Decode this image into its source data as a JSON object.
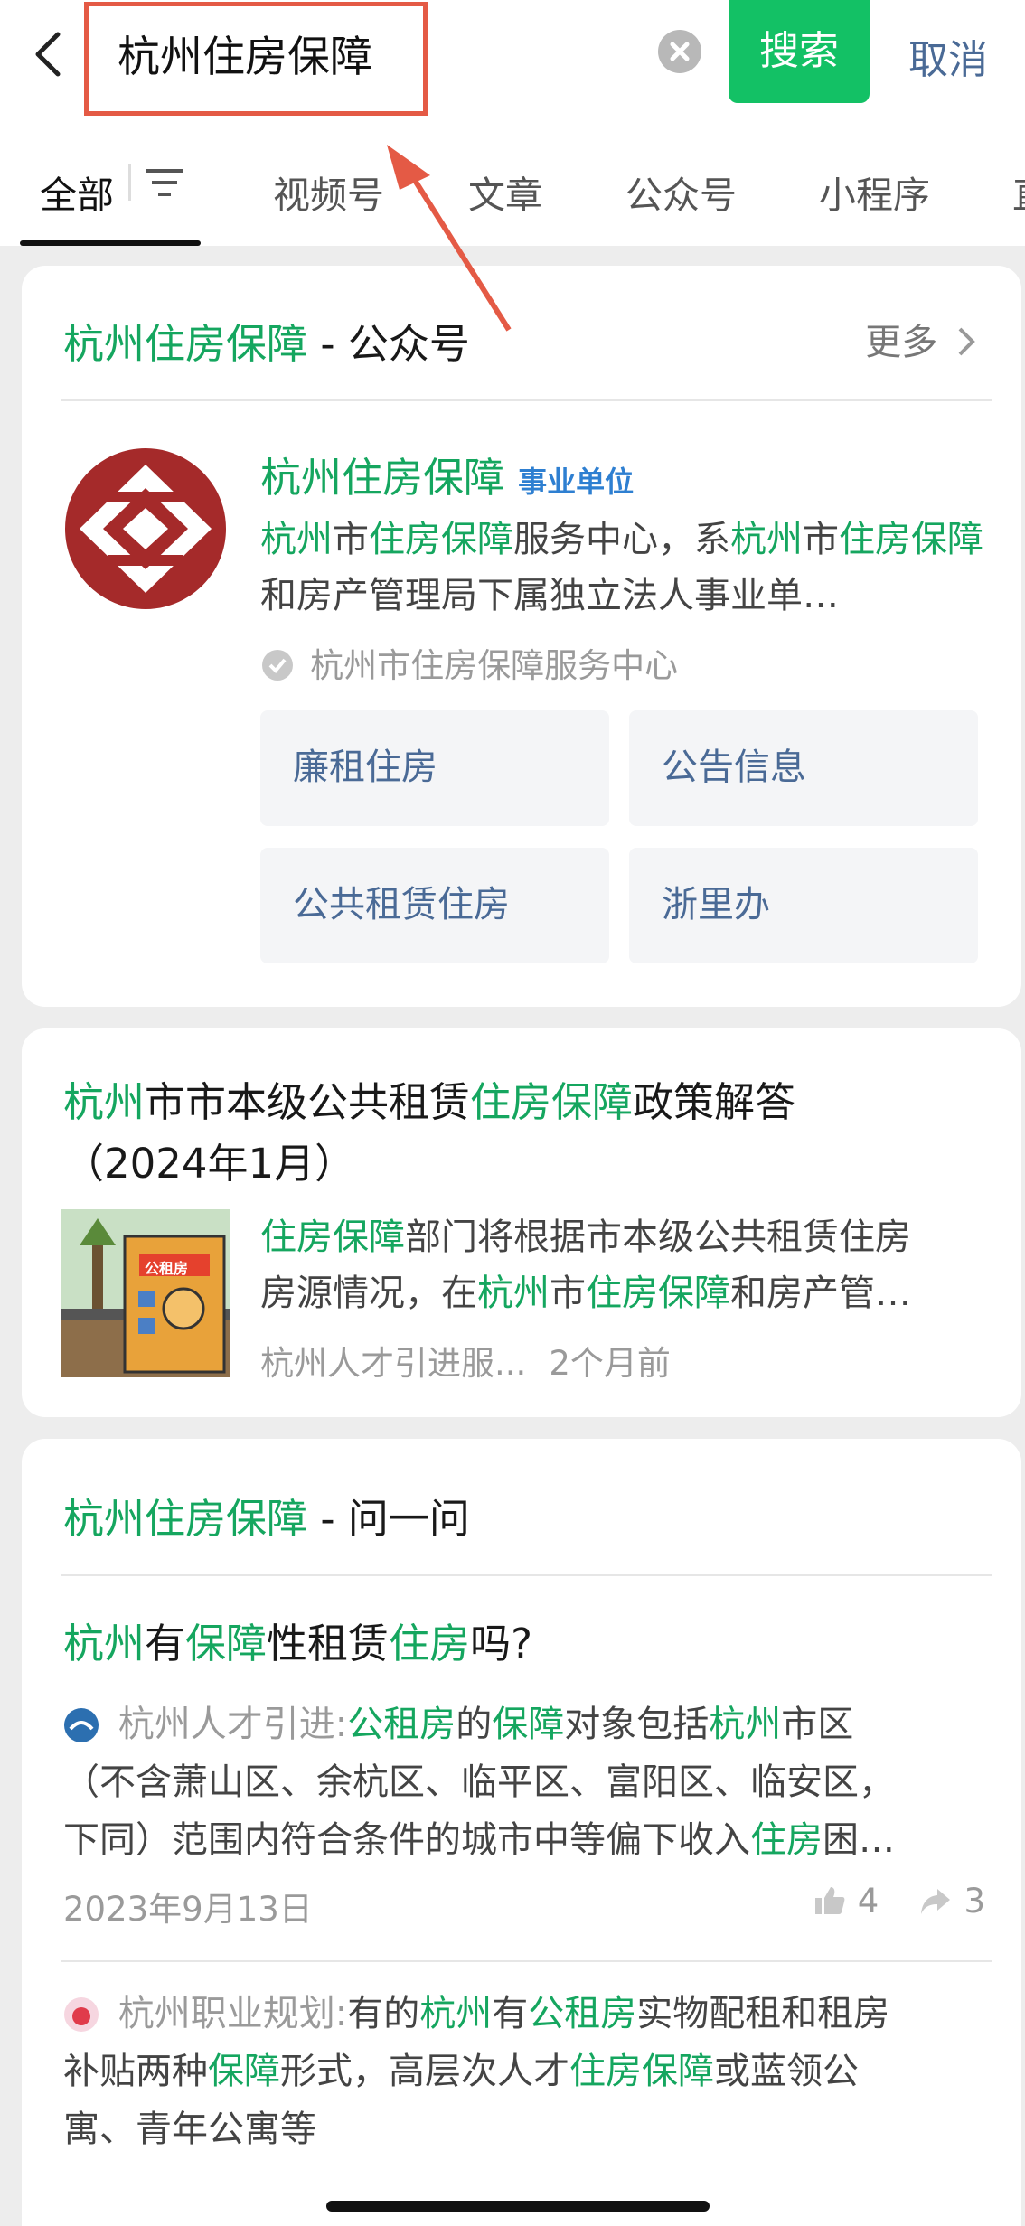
{
  "header": {
    "search_value": "杭州住房保障",
    "search_button": "搜索",
    "cancel": "取消"
  },
  "tabs": [
    "全部",
    "视频号",
    "文章",
    "公众号",
    "小程序",
    "直"
  ],
  "account_card": {
    "title_hl": "杭州住房保障",
    "title_rest": " - 公众号",
    "more": "更多",
    "name": "杭州住房保障",
    "tag": "事业单位",
    "desc_parts": [
      {
        "t": "杭州",
        "h": true
      },
      {
        "t": "市",
        "h": false
      },
      {
        "t": "住房保障",
        "h": true
      },
      {
        "t": "服务中心，系",
        "h": false
      },
      {
        "t": "杭州",
        "h": true
      },
      {
        "t": "市",
        "h": false
      },
      {
        "t": "住房保障",
        "h": true
      },
      {
        "t": "和房产管理局下属独立法人事业单…",
        "h": false
      }
    ],
    "verified": "杭州市住房保障服务中心",
    "quick_links": [
      "廉租住房",
      "公告信息",
      "公共租赁住房",
      "浙里办"
    ]
  },
  "article_card": {
    "title_parts": [
      {
        "t": "杭州",
        "h": true
      },
      {
        "t": "市市本级公共租赁",
        "h": false
      },
      {
        "t": "住房保障",
        "h": true
      },
      {
        "t": "政策解答",
        "h": false
      }
    ],
    "title_line2": "（2024年1月）",
    "snippet_parts": [
      {
        "t": "住房保障",
        "h": true
      },
      {
        "t": "部门将根据市本级公共租赁住房",
        "h": false
      }
    ],
    "snippet_line2_parts": [
      {
        "t": "房源情况，在",
        "h": false
      },
      {
        "t": "杭州",
        "h": true
      },
      {
        "t": "市",
        "h": false
      },
      {
        "t": "住房保障",
        "h": true
      },
      {
        "t": "和房产管…",
        "h": false
      }
    ],
    "thumb_label": "公租房",
    "source": "杭州人才引进服...",
    "time": "2个月前"
  },
  "qa_card": {
    "title_hl": "杭州住房保障",
    "title_rest": " - 问一问",
    "question_parts": [
      {
        "t": "杭州",
        "h": true
      },
      {
        "t": "有",
        "h": false
      },
      {
        "t": "保障",
        "h": true
      },
      {
        "t": "性租赁",
        "h": false
      },
      {
        "t": "住房",
        "h": true
      },
      {
        "t": "吗?",
        "h": false
      }
    ],
    "answer1": {
      "author": "杭州人才引进:",
      "l1": [
        {
          "t": "公租房",
          "h": true
        },
        {
          "t": "的",
          "h": false
        },
        {
          "t": "保障",
          "h": true
        },
        {
          "t": "对象包括",
          "h": false
        },
        {
          "t": "杭州",
          "h": true
        },
        {
          "t": "市区",
          "h": false
        }
      ],
      "l2": "（不含萧山区、余杭区、临平区、富阳区、临安区，",
      "l3": [
        {
          "t": "下同）范围内符合条件的城市中等偏下收入",
          "h": false
        },
        {
          "t": "住房",
          "h": true
        },
        {
          "t": "困…",
          "h": false
        }
      ],
      "date": "2023年9月13日",
      "likes": "4",
      "shares": "3"
    },
    "answer2": {
      "author": "杭州职业规划:",
      "l1": [
        {
          "t": "有的",
          "h": false
        },
        {
          "t": "杭州",
          "h": true
        },
        {
          "t": "有",
          "h": false
        },
        {
          "t": "公租房",
          "h": true
        },
        {
          "t": "实物配租和租房",
          "h": false
        }
      ],
      "l2": [
        {
          "t": "补贴两种",
          "h": false
        },
        {
          "t": "保障",
          "h": true
        },
        {
          "t": "形式，高层次人才",
          "h": false
        },
        {
          "t": "住房保障",
          "h": true
        },
        {
          "t": "或蓝领公",
          "h": false
        }
      ],
      "l3": "寓、青年公寓等"
    }
  },
  "colors": {
    "accent": "#13c165",
    "highlight": "#15a65f",
    "link": "#4a6a96",
    "annotation": "#e45a45"
  }
}
